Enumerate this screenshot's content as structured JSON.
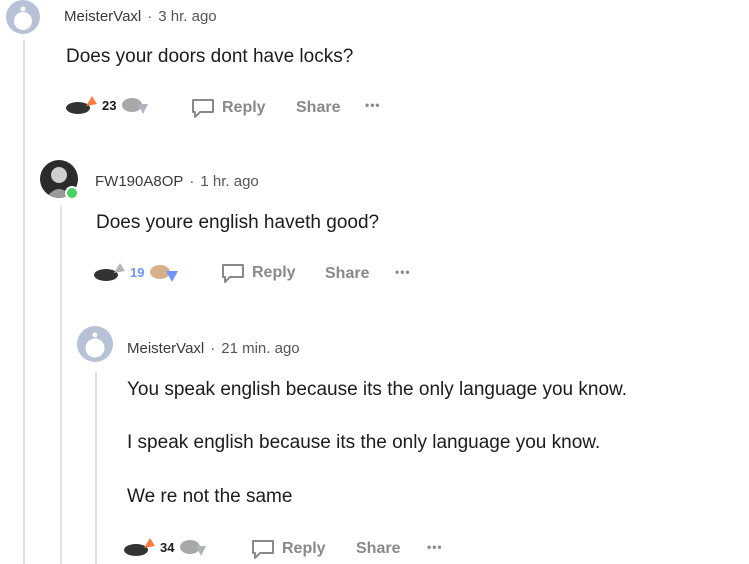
{
  "colors": {
    "upvote": "#ff4500",
    "downvote": "#7193ff",
    "muted": "#878a8c"
  },
  "comments": [
    {
      "username": "MeisterVaxl",
      "dot": "·",
      "time": "3 hr. ago",
      "lines": [
        "Does your doors dont have locks?"
      ],
      "votes": "23",
      "reply": "Reply",
      "share": "Share",
      "more": "•••"
    },
    {
      "username": "FW190A8OP",
      "dot": "·",
      "time": "1 hr. ago",
      "lines": [
        "Does youre english haveth good?"
      ],
      "votes": "19",
      "reply": "Reply",
      "share": "Share",
      "more": "•••"
    },
    {
      "username": "MeisterVaxl",
      "dot": "·",
      "time": "21 min. ago",
      "lines": [
        "You speak english because its the only language you know.",
        "I speak english because its the only language you know.",
        "We re not the same"
      ],
      "votes": "34",
      "reply": "Reply",
      "share": "Share",
      "more": "•••"
    }
  ]
}
